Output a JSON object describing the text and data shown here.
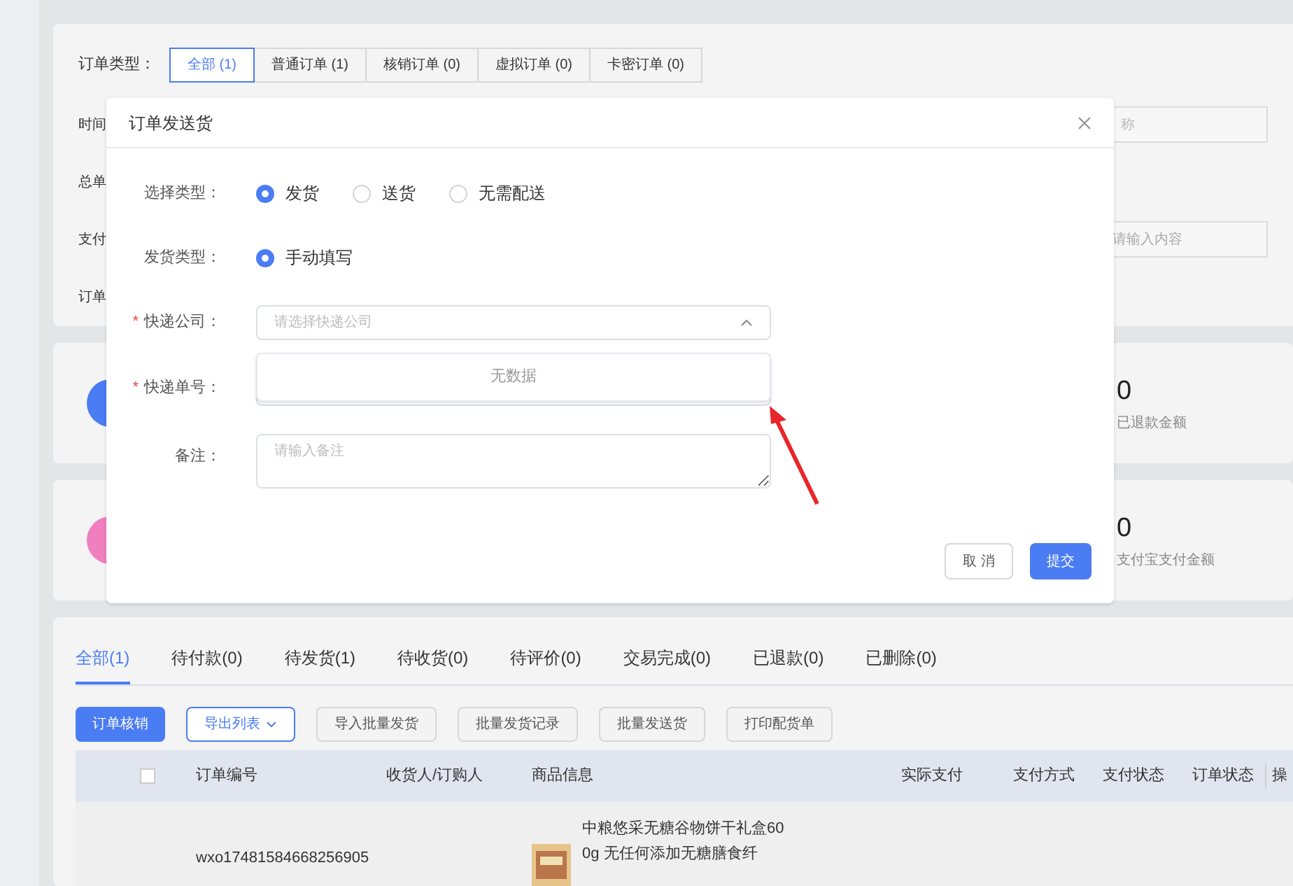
{
  "filters": {
    "order_type": {
      "label": "订单类型：",
      "options": [
        {
          "label": "全部 (1)",
          "selected": true
        },
        {
          "label": "普通订单 (1)",
          "selected": false
        },
        {
          "label": "核销订单 (0)",
          "selected": false
        },
        {
          "label": "虚拟订单 (0)",
          "selected": false
        },
        {
          "label": "卡密订单 (0)",
          "selected": false
        }
      ]
    },
    "row_labels": [
      "时间",
      "总单",
      "支付",
      "订单"
    ],
    "name_placeholder": "称",
    "content_placeholder": "请输入内容"
  },
  "stats": [
    {
      "value": "0",
      "label": "已退款金额",
      "color": "#4a7cf3"
    },
    {
      "value": "0",
      "label": "支付宝支付金额",
      "color": "#f07fbf"
    }
  ],
  "tabs": [
    {
      "label": "全部(1)",
      "selected": true
    },
    {
      "label": "待付款(0)",
      "selected": false
    },
    {
      "label": "待发货(1)",
      "selected": false
    },
    {
      "label": "待收货(0)",
      "selected": false
    },
    {
      "label": "待评价(0)",
      "selected": false
    },
    {
      "label": "交易完成(0)",
      "selected": false
    },
    {
      "label": "已退款(0)",
      "selected": false
    },
    {
      "label": "已删除(0)",
      "selected": false
    }
  ],
  "actions": [
    {
      "label": "订单核销",
      "kind": "primary"
    },
    {
      "label": "导出列表",
      "kind": "dropdown"
    },
    {
      "label": "导入批量发货",
      "kind": "plain"
    },
    {
      "label": "批量发货记录",
      "kind": "plain"
    },
    {
      "label": "批量发送货",
      "kind": "plain"
    },
    {
      "label": "打印配货单",
      "kind": "plain"
    }
  ],
  "table": {
    "select_all": {
      "checked": false
    },
    "columns": [
      "订单编号",
      "收货人/订购人",
      "商品信息",
      "实际支付",
      "支付方式",
      "支付状态",
      "订单状态",
      "操"
    ],
    "rows": [
      {
        "order_no": "wxo17481584668256905",
        "product": "中粮悠采无糖谷物饼干礼盒600g 无任何添加无糖膳食纤"
      }
    ]
  },
  "dialog": {
    "title": "订单发送货",
    "required_mark": "*",
    "select_type": {
      "label": "选择类型：",
      "options": [
        {
          "label": "发货",
          "selected": true
        },
        {
          "label": "送货",
          "selected": false
        },
        {
          "label": "无需配送",
          "selected": false
        }
      ]
    },
    "ship_type": {
      "label": "发货类型：",
      "options": [
        {
          "label": "手动填写",
          "selected": true
        }
      ]
    },
    "courier": {
      "label": "快递公司：",
      "required": true,
      "placeholder": "请选择快递公司",
      "expanded": true,
      "empty_text": "无数据"
    },
    "tracking": {
      "label": "快递单号：",
      "required": true
    },
    "note": {
      "label": "备注：",
      "placeholder": "请输入备注"
    },
    "buttons": [
      {
        "label": "取 消",
        "kind": "cancel"
      },
      {
        "label": "提交",
        "kind": "primary"
      }
    ]
  }
}
